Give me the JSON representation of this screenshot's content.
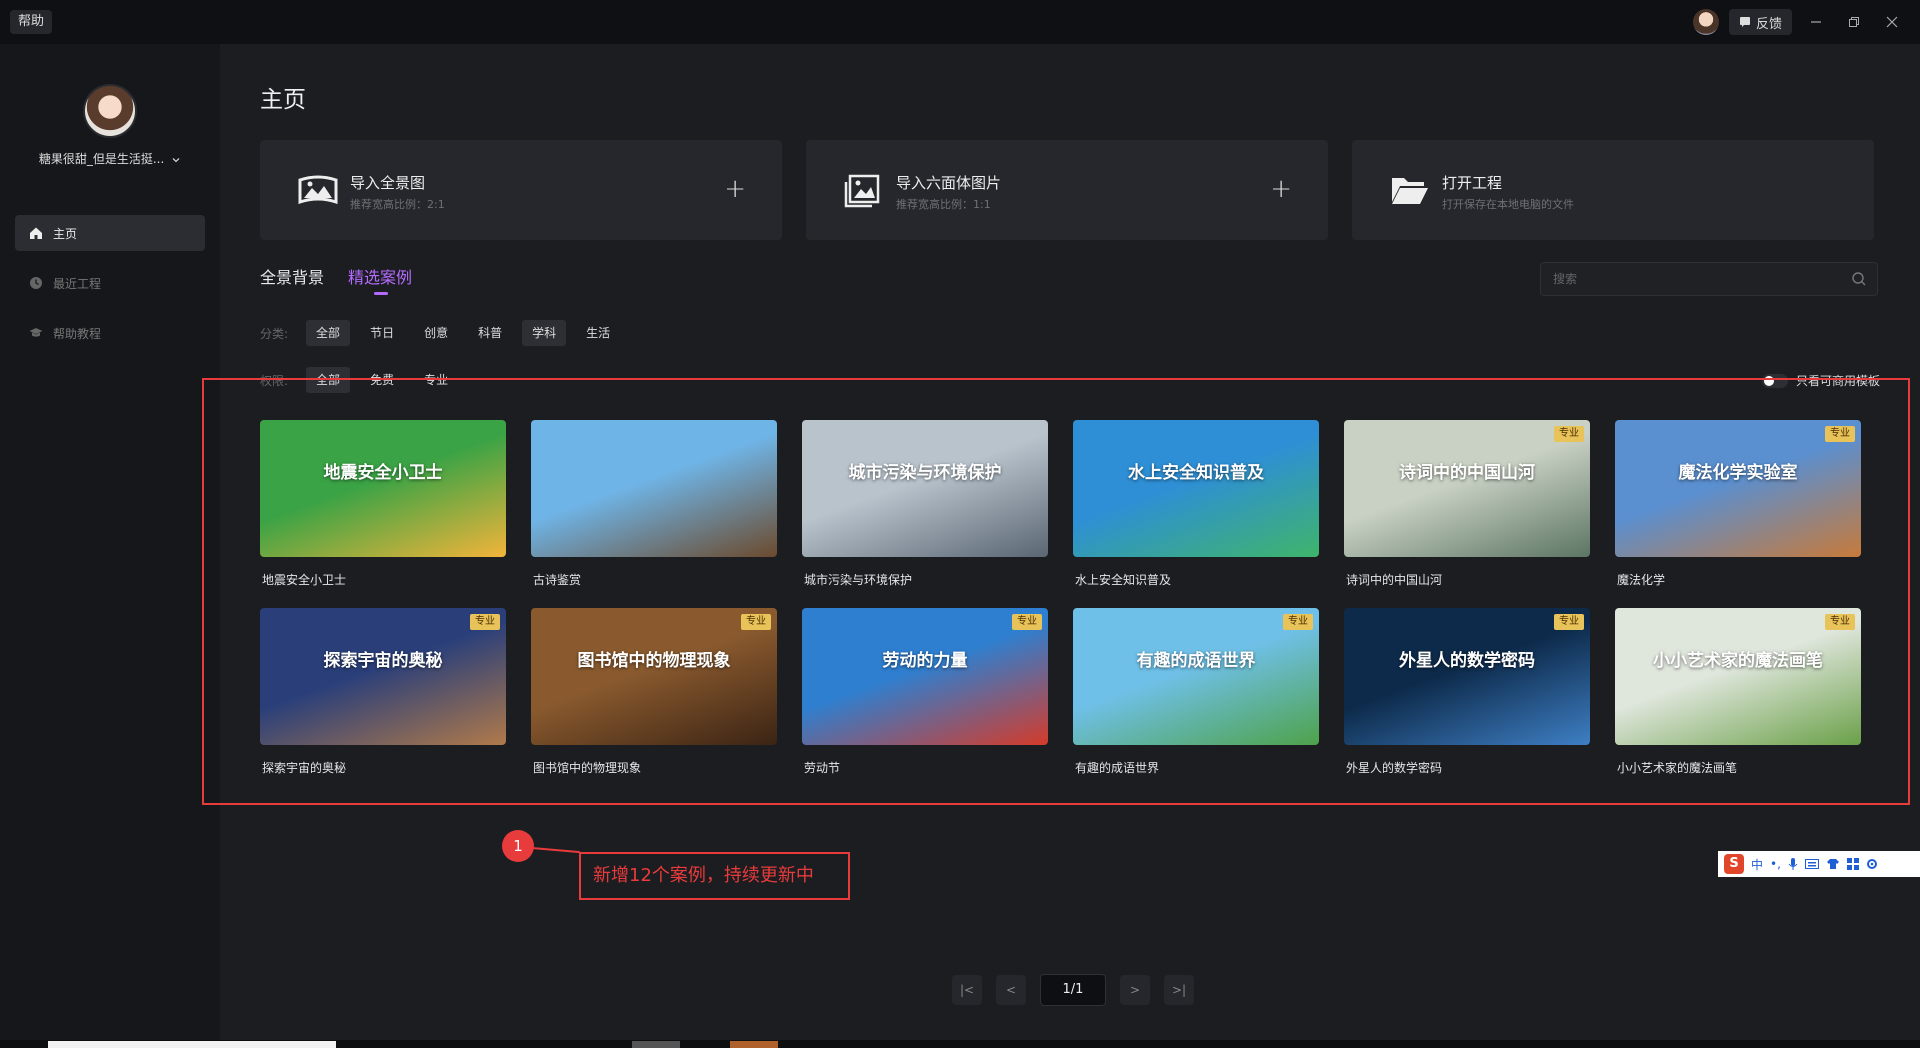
{
  "titlebar": {
    "help": "帮助",
    "feedback": "反馈"
  },
  "sidebar": {
    "username": "糖果很甜_但是生活挺...",
    "items": [
      {
        "label": "主页",
        "icon": "home-icon"
      },
      {
        "label": "最近工程",
        "icon": "clock-icon"
      },
      {
        "label": "帮助教程",
        "icon": "graduation-cap-icon"
      }
    ]
  },
  "main": {
    "title": "主页",
    "import_cards": [
      {
        "title": "导入全景图",
        "sub": "推荐宽高比例：2:1",
        "plus": "+"
      },
      {
        "title": "导入六面体图片",
        "sub": "推荐宽高比例：1:1",
        "plus": "+"
      },
      {
        "title": "打开工程",
        "sub": "打开保存在本地电脑的文件"
      }
    ],
    "tabs": [
      "全景背景",
      "精选案例"
    ],
    "search_placeholder": "搜索",
    "category": {
      "label": "分类:",
      "options": [
        "全部",
        "节日",
        "创意",
        "科普",
        "学科",
        "生活"
      ]
    },
    "permission": {
      "label": "权限:",
      "options": [
        "全部",
        "免费",
        "专业"
      ]
    },
    "commercial_only": "只看可商用模板",
    "pro_label": "专业"
  },
  "cases": [
    {
      "name": "地震安全小卫士",
      "thumb_title": "地震安全小卫士",
      "pro": false,
      "colors": [
        "#3aa345",
        "#f2b43a"
      ]
    },
    {
      "name": "古诗鉴赏",
      "thumb_title": "",
      "pro": false,
      "colors": [
        "#6fb4e6",
        "#6b4a2d"
      ]
    },
    {
      "name": "城市污染与环境保护",
      "thumb_title": "城市污染与环境保护",
      "pro": false,
      "colors": [
        "#b9c3cc",
        "#5a6673"
      ]
    },
    {
      "name": "水上安全知识普及",
      "thumb_title": "水上安全知识普及",
      "pro": false,
      "colors": [
        "#2e8fd6",
        "#3fb46b"
      ]
    },
    {
      "name": "诗词中的中国山河",
      "thumb_title": "诗词中的中国山河",
      "pro": true,
      "colors": [
        "#c9d1c4",
        "#5c7563"
      ]
    },
    {
      "name": "魔法化学",
      "thumb_title": "魔法化学实验室",
      "pro": true,
      "colors": [
        "#5a8fd0",
        "#c77a3a"
      ]
    },
    {
      "name": "探索宇宙的奥秘",
      "thumb_title": "探索宇宙的奥秘",
      "pro": true,
      "colors": [
        "#2a3f7a",
        "#b07a4a"
      ]
    },
    {
      "name": "图书馆中的物理现象",
      "thumb_title": "图书馆中的物理现象",
      "pro": true,
      "colors": [
        "#8a5a2e",
        "#3b2414"
      ]
    },
    {
      "name": "劳动节",
      "thumb_title": "劳动的力量",
      "pro": true,
      "colors": [
        "#2e7fd0",
        "#d43b2a"
      ]
    },
    {
      "name": "有趣的成语世界",
      "thumb_title": "有趣的成语世界",
      "pro": true,
      "colors": [
        "#6fc0e8",
        "#4ea24a"
      ]
    },
    {
      "name": "外星人的数学密码",
      "thumb_title": "外星人的数学密码",
      "pro": true,
      "colors": [
        "#0d2a4a",
        "#3e7fc4"
      ]
    },
    {
      "name": "小小艺术家的魔法画笔",
      "thumb_title": "小小艺术家的魔法画笔",
      "pro": true,
      "colors": [
        "#dfe6dc",
        "#6aa048"
      ]
    }
  ],
  "annotation": {
    "number": "1",
    "text": "新增12个案例，持续更新中"
  },
  "ime": {
    "lang": "中",
    "punct": "•,"
  },
  "pager": {
    "first": "|<",
    "prev": "<",
    "current": "1/1",
    "next": ">",
    "last": ">|"
  }
}
